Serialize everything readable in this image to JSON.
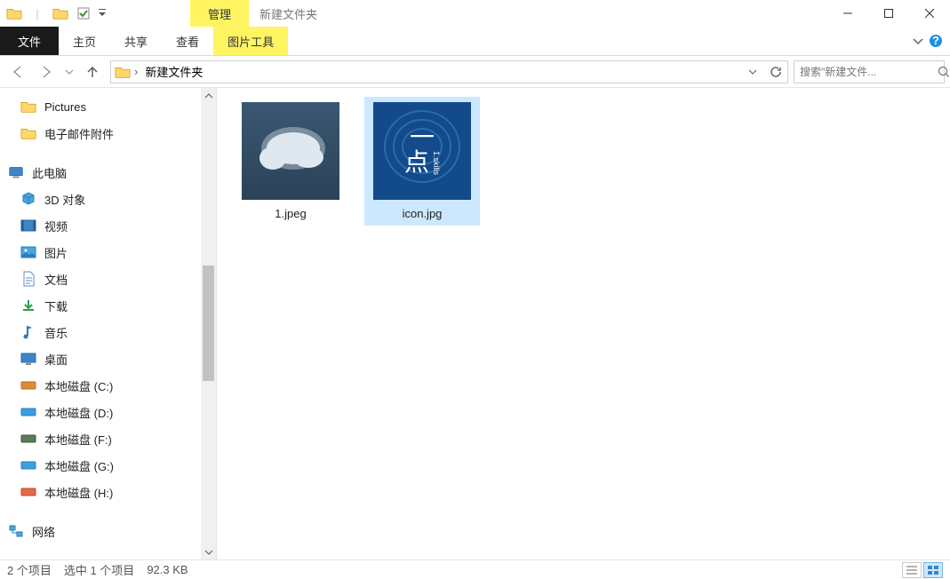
{
  "window": {
    "title": "新建文件夹",
    "manage_tab": "管理"
  },
  "ribbon": {
    "file": "文件",
    "home": "主页",
    "share": "共享",
    "view": "查看",
    "pic_tools": "图片工具"
  },
  "address": {
    "crumb": "新建文件夹",
    "search_placeholder": "搜索\"新建文件..."
  },
  "tree": {
    "quick1": "Pictures",
    "quick2": "电子邮件附件",
    "this_pc": "此电脑",
    "items": [
      "3D 对象",
      "视频",
      "图片",
      "文档",
      "下载",
      "音乐",
      "桌面",
      "本地磁盘 (C:)",
      "本地磁盘 (D:)",
      "本地磁盘 (F:)",
      "本地磁盘 (G:)",
      "本地磁盘 (H:)"
    ],
    "network": "网络"
  },
  "files": [
    {
      "name": "1.jpeg"
    },
    {
      "name": "icon.jpg"
    }
  ],
  "status": {
    "count": "2 个项目",
    "selected": "选中 1 个项目",
    "size": "92.3 KB"
  },
  "thumb2": {
    "line1": "一",
    "line2": "点",
    "side": "1.skills"
  }
}
